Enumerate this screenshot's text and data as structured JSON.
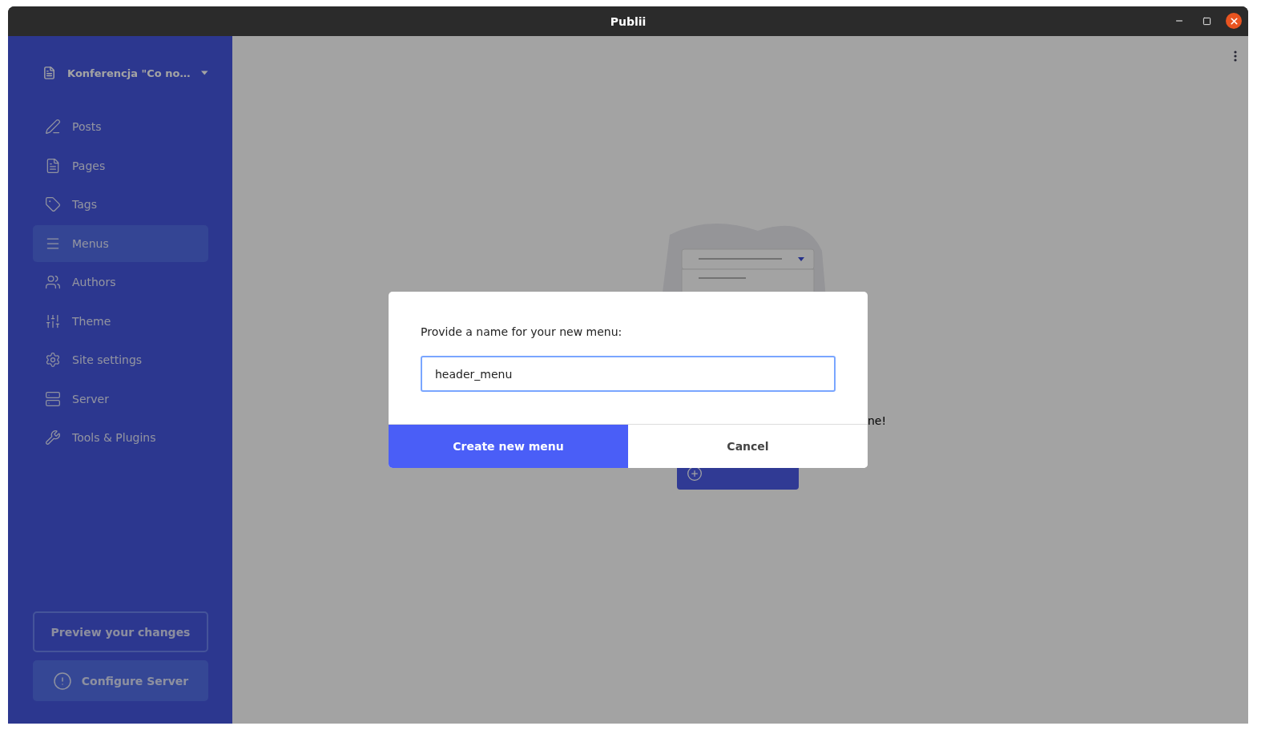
{
  "window": {
    "title": "Publii"
  },
  "sidebar": {
    "site": {
      "name": "Konferencja \"Co no…"
    },
    "items": [
      {
        "label": "Posts",
        "selected": false
      },
      {
        "label": "Pages",
        "selected": false
      },
      {
        "label": "Tags",
        "selected": false
      },
      {
        "label": "Menus",
        "selected": true
      },
      {
        "label": "Authors",
        "selected": false
      },
      {
        "label": "Theme",
        "selected": false
      },
      {
        "label": "Site settings",
        "selected": false
      },
      {
        "label": "Server",
        "selected": false
      },
      {
        "label": "Tools & Plugins",
        "selected": false
      }
    ],
    "buttons": [
      {
        "label": "Preview your changes",
        "kind": "outline"
      },
      {
        "label": "Configure Server",
        "kind": "warning"
      }
    ]
  },
  "content": {
    "empty_state": {
      "message": "ne!",
      "add_button_visible": true
    }
  },
  "dialog": {
    "label": "Provide a name for your new menu:",
    "field": {
      "value": "header_menu",
      "focused": true
    },
    "buttons": [
      {
        "label": "Create new menu",
        "kind": "primary"
      },
      {
        "label": "Cancel",
        "kind": "secondary"
      }
    ]
  }
}
